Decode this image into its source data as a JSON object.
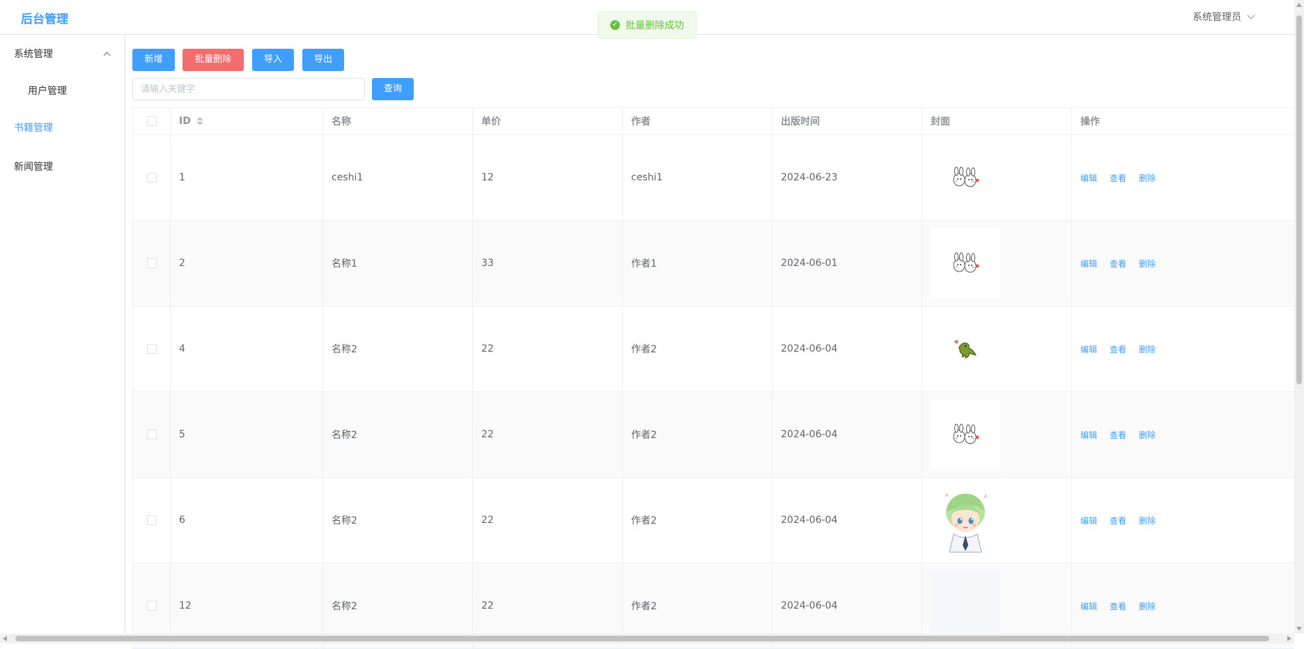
{
  "app": {
    "title": "后台管理",
    "user": "系统管理员"
  },
  "toast": {
    "text": "批量删除成功"
  },
  "sidebar": {
    "items": [
      {
        "label": "系统管理"
      },
      {
        "label": "用户管理"
      },
      {
        "label": "书籍管理"
      },
      {
        "label": "新闻管理"
      }
    ]
  },
  "toolbar": {
    "add": "新增",
    "batch_delete": "批量删除",
    "import": "导入",
    "export": "导出",
    "search_placeholder": "请输入关键字",
    "search": "查询"
  },
  "table": {
    "columns": [
      "ID",
      "名称",
      "单价",
      "作者",
      "出版时间",
      "封面",
      "操作"
    ],
    "actions": {
      "edit": "编辑",
      "view": "查看",
      "delete": "删除"
    },
    "rows": [
      {
        "id": "1",
        "name": "ceshi1",
        "price": "12",
        "author": "ceshi1",
        "date": "2024-06-23",
        "cover": "rabbits-sticker"
      },
      {
        "id": "2",
        "name": "名称1",
        "price": "33",
        "author": "作者1",
        "date": "2024-06-01",
        "cover": "rabbits-sticker"
      },
      {
        "id": "4",
        "name": "名称2",
        "price": "22",
        "author": "作者2",
        "date": "2024-06-04",
        "cover": "dinosaur-sticker"
      },
      {
        "id": "5",
        "name": "名称2",
        "price": "22",
        "author": "作者2",
        "date": "2024-06-04",
        "cover": "rabbits-sticker"
      },
      {
        "id": "6",
        "name": "名称2",
        "price": "22",
        "author": "作者2",
        "date": "2024-06-04",
        "cover": "anime-boy"
      },
      {
        "id": "12",
        "name": "名称2",
        "price": "22",
        "author": "作者2",
        "date": "2024-06-04",
        "cover": "empty"
      }
    ]
  },
  "colors": {
    "primary": "#409eff",
    "danger": "#f56c6c",
    "success": "#67c23a"
  }
}
